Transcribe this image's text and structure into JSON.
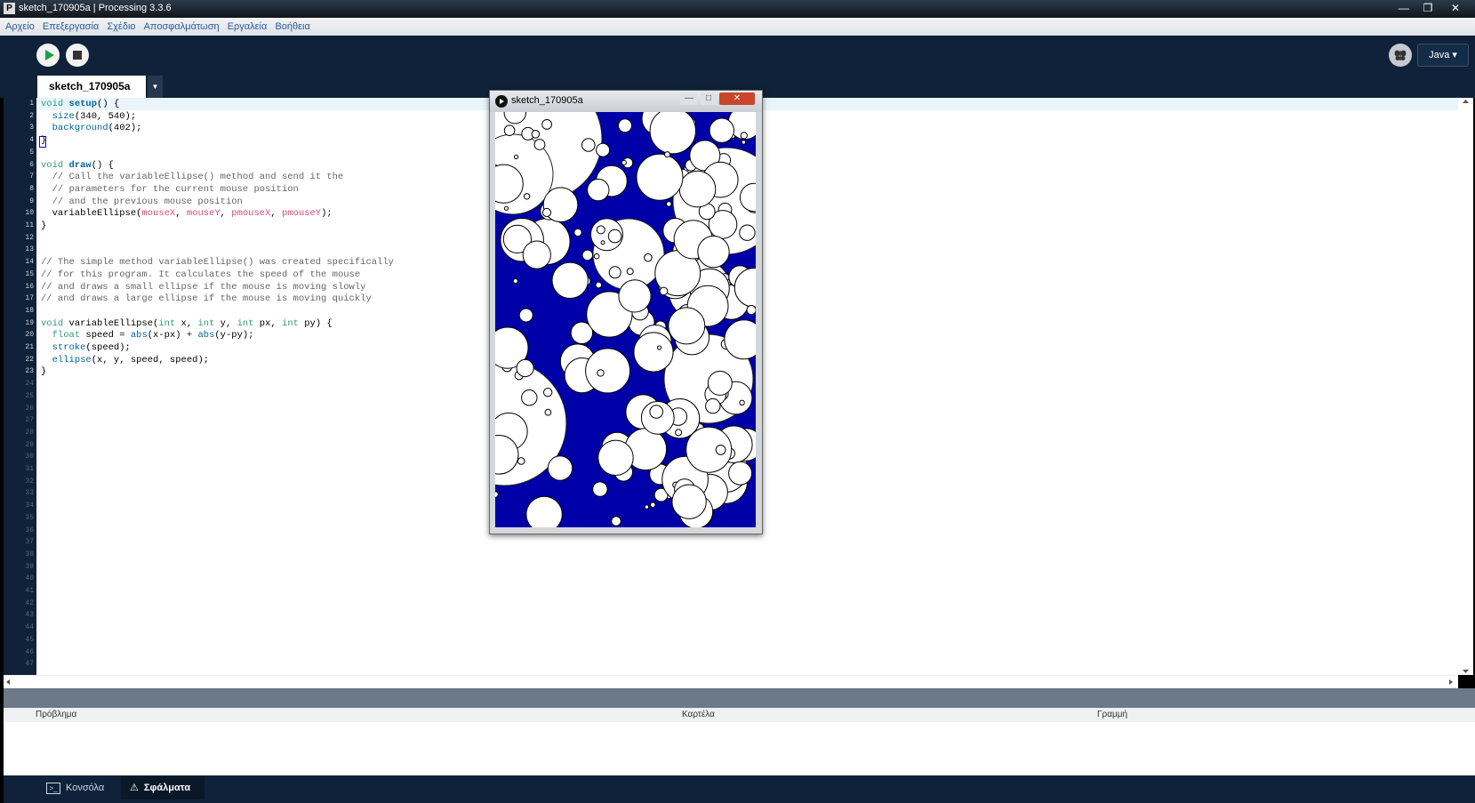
{
  "window": {
    "title": "sketch_170905a | Processing 3.3.6",
    "controls": [
      "—",
      "❐",
      "✕"
    ]
  },
  "menu": [
    "Αρχείο",
    "Επεξεργασία",
    "Σχέδιο",
    "Αποσφαλμάτωση",
    "Εργαλεία",
    "Βοήθεια"
  ],
  "toolbar": {
    "mode": "Java ▾"
  },
  "tabs": {
    "active": "sketch_170905a",
    "menu_glyph": "▼"
  },
  "code": {
    "lines": [
      "void setup() {",
      "  size(340, 540);",
      "  background(402);",
      "}",
      "",
      "void draw() {",
      "  // Call the variableEllipse() method and send it the",
      "  // parameters for the current mouse position",
      "  // and the previous mouse position",
      "  variableEllipse(mouseX, mouseY, pmouseX, pmouseY);",
      "}",
      "",
      "",
      "// The simple method variableEllipse() was created specifically",
      "// for this program. It calculates the speed of the mouse",
      "// and draws a small ellipse if the mouse is moving slowly",
      "// and draws a large ellipse if the mouse is moving quickly",
      "",
      "void variableEllipse(int x, int y, int px, int py) {",
      "  float speed = abs(x-px) + abs(y-py);",
      "  stroke(speed);",
      "  ellipse(x, y, speed, speed);",
      "}"
    ],
    "line_count": 47
  },
  "messages": {
    "columns": [
      "Πρόβλημα",
      "Καρτέλα",
      "Γραμμή"
    ]
  },
  "footer_tabs": [
    "Κονσόλα",
    "Σφάλματα"
  ],
  "sketch_window": {
    "title": "sketch_170905a",
    "background_color": "#0000a8"
  },
  "colors": {
    "toolbar_bg": "#0f2239",
    "keyword": "#33997e",
    "function": "#006699",
    "mouse_var": "#d94a7a",
    "comment": "#666666"
  }
}
